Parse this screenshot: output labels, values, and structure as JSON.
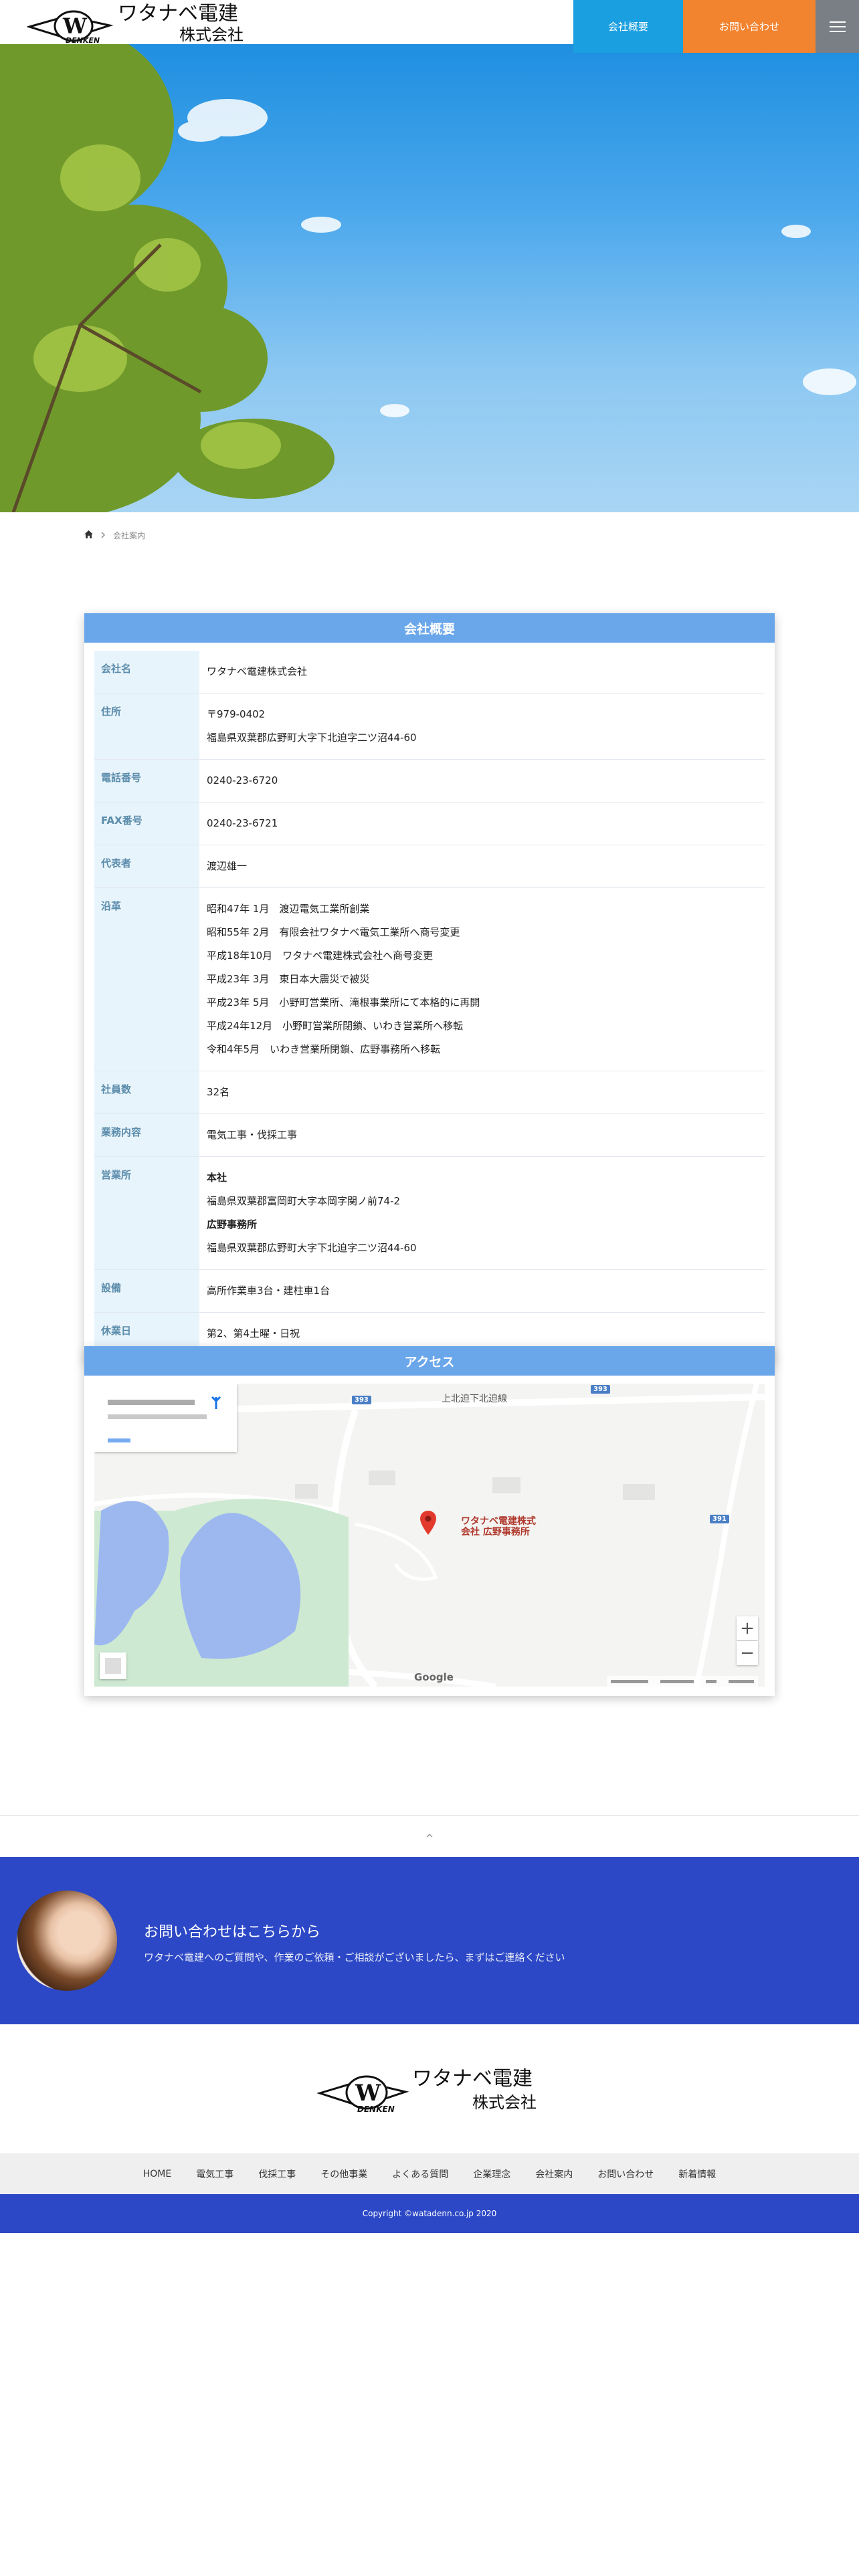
{
  "header": {
    "logo_text_line1": "ワタナベ電建",
    "logo_text_line2": "株式会社",
    "logo_mark_letter": "W",
    "logo_mark_word": "DENKEN",
    "nav": [
      {
        "label": "会社概要",
        "color": "#1a9fe0"
      },
      {
        "label": "お問い合わせ",
        "color": "#f2832f"
      }
    ],
    "menu_icon": "hamburger-icon"
  },
  "breadcrumb": {
    "home_icon": "home-icon",
    "separator_icon": "chevron-right-icon",
    "current": "会社案内"
  },
  "company": {
    "title": "会社概要",
    "rows": [
      {
        "label": "会社名",
        "lines": [
          "ワタナベ電建株式会社"
        ]
      },
      {
        "label": "住所",
        "lines": [
          "〒979-0402",
          "福島県双葉郡広野町大字下北迫字二ツ沼44-60"
        ]
      },
      {
        "label": "電話番号",
        "lines": [
          "0240-23-6720"
        ]
      },
      {
        "label": "FAX番号",
        "lines": [
          "0240-23-6721"
        ]
      },
      {
        "label": "代表者",
        "lines": [
          "渡辺雄一"
        ]
      },
      {
        "label": "沿革",
        "lines": [
          "昭和47年 1月　渡辺電気工業所創業",
          "昭和55年 2月　有限会社ワタナベ電気工業所へ商号変更",
          "平成18年10月　ワタナベ電建株式会社へ商号変更",
          "平成23年 3月　東日本大震災で被災",
          "平成23年 5月　小野町営業所、滝根事業所にて本格的に再開",
          "平成24年12月　小野町営業所閉鎖、いわき営業所へ移転",
          "令和4年5月　いわき営業所閉鎖、広野事務所へ移転"
        ]
      },
      {
        "label": "社員数",
        "lines": [
          "32名"
        ]
      },
      {
        "label": "業務内容",
        "lines": [
          "電気工事・伐採工事"
        ]
      },
      {
        "label": "営業所",
        "lines": [
          "本社",
          "福島県双葉郡富岡町大字本岡字関ノ前74-2",
          "広野事務所",
          "福島県双葉郡広野町大字下北迫字二ツ沼44-60"
        ],
        "bold_lines": [
          0,
          2
        ]
      },
      {
        "label": "設備",
        "lines": [
          "高所作業車3台・建柱車1台"
        ]
      },
      {
        "label": "休業日",
        "lines": [
          "第2、第4土曜・日祝"
        ]
      }
    ]
  },
  "access": {
    "title": "アクセス",
    "map": {
      "road_label": "上北迫下北迫線",
      "pin_label_line1": "ワタナベ電建株式",
      "pin_label_line2": "会社 広野事務所",
      "route_numbers": [
        "393",
        "393",
        "391"
      ],
      "zoom_in": "+",
      "zoom_out": "−",
      "provider": "Google",
      "pin_icon": "map-pin-icon",
      "directions_icon": "directions-icon"
    }
  },
  "pagetop_icon": "chevron-up-icon",
  "contact": {
    "title": "お問い合わせはこちらから",
    "subtitle": "ワタナベ電建へのご質問や、作業のご依頼・ご相談がございましたら、まずはご連絡ください",
    "band_color": "#2c48c6"
  },
  "footer": {
    "nav": [
      "HOME",
      "電気工事",
      "伐採工事",
      "その他事業",
      "よくある質問",
      "企業理念",
      "会社案内",
      "お問い合わせ",
      "新着情報"
    ],
    "copyright": "Copyright ©watadenn.co.jp 2020"
  }
}
